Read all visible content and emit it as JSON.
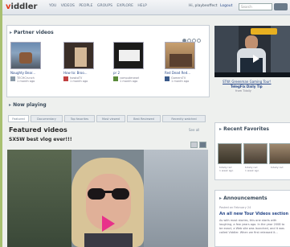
{
  "header": {
    "logo_prefix": "",
    "logo_accent": "v",
    "logo_rest": "iddler",
    "nav": [
      "YOU",
      "VIDEOS",
      "PEOPLE",
      "GROUPS",
      "EXPLORE",
      "HELP"
    ],
    "user_line": "Hi, playbeoffect",
    "logout": "Logout",
    "search_placeholder": "Search"
  },
  "partner_videos": {
    "title": "Partner videos",
    "items": [
      {
        "caption": "Naughty Bear...",
        "meta": "TECHCrunch\n1 month ago"
      },
      {
        "caption": "How to: Broo...",
        "meta": "howtoTV\n1 month ago"
      },
      {
        "caption": "pr 2",
        "meta": "computerworl\n1 month ago"
      },
      {
        "caption": "Red Dead Red...",
        "meta": "GamersTV\n1 month ago"
      }
    ],
    "featured_caption": "STW: Greenman Gaming Tour!",
    "featured_line2": "TelegFix Daily Tip",
    "featured_line3": "from Tdaily"
  },
  "now_playing": {
    "title": "Now playing",
    "tabs": [
      "Featured",
      "Documentary",
      "Top favorites",
      "Most viewed",
      "Best Reviewed",
      "Recently watched"
    ]
  },
  "featured_videos": {
    "title": "Featured videos",
    "see_all": "See all",
    "video_title": "SXSW best vlog ever!!!"
  },
  "recent_favorites": {
    "title": "Recent Favorites",
    "items": [
      {
        "meta": "totally rad\n1 week ago"
      },
      {
        "meta": "totally rad\n1 week ago"
      },
      {
        "meta": "totally rad"
      }
    ]
  },
  "announcements": {
    "title": "Announcements",
    "date": "Posted on February 24",
    "headline": "An all new Tour Videos section",
    "body": "As with most stories, this one starts with laughing, a few years ago. In the year 2008 to be exact, a Web site was launched, and it was called Viddler. When we first released it..."
  },
  "colors": {
    "accent": "#e03a1a",
    "link": "#2a4a8a",
    "border_green": "#a8c070"
  }
}
